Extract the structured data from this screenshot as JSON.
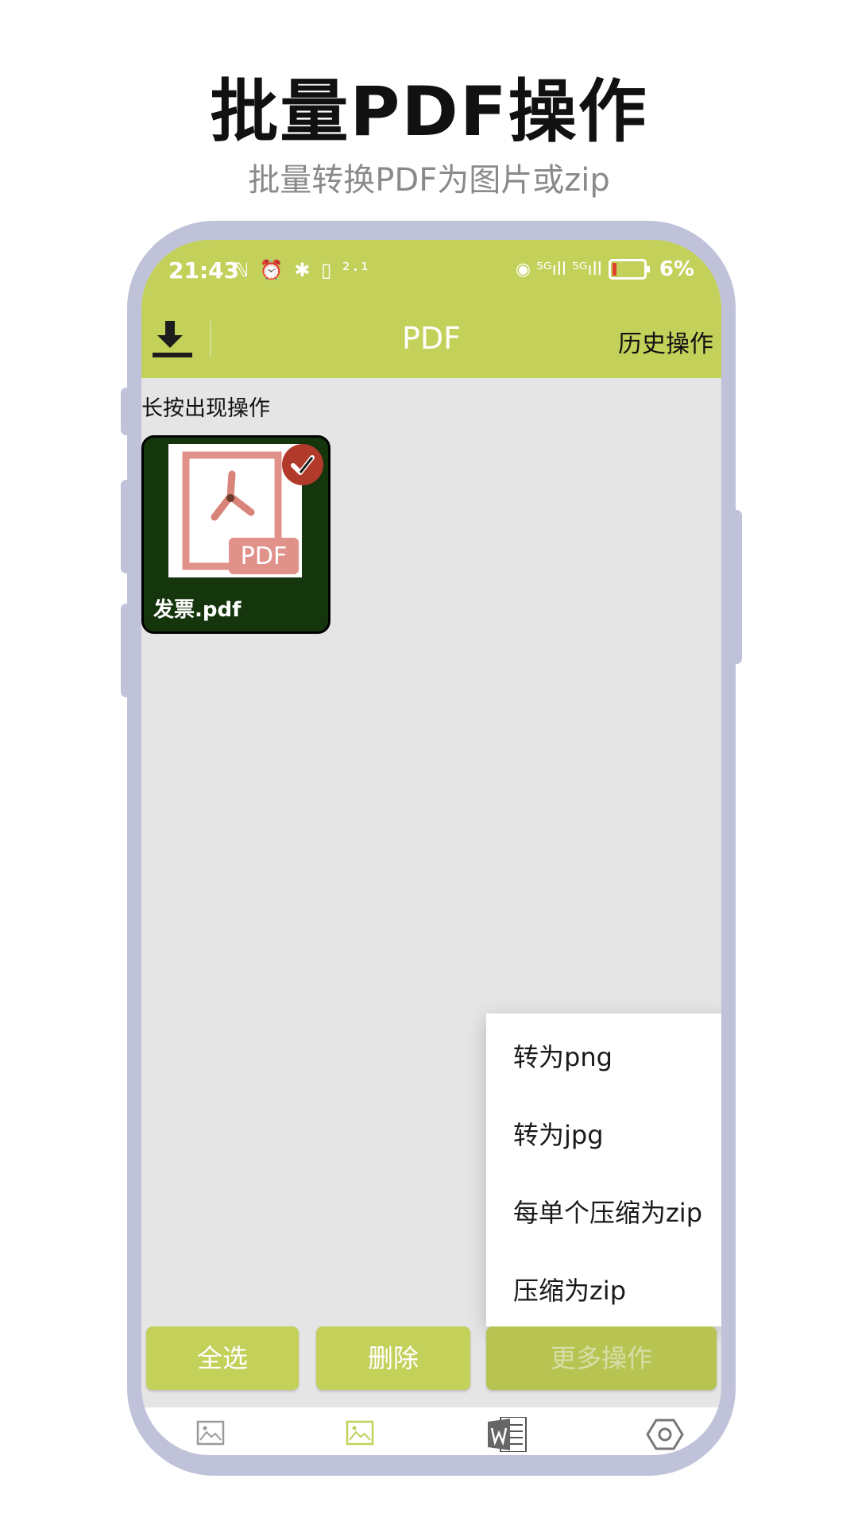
{
  "promo": {
    "headline": "批量PDF操作",
    "subheadline": "批量转换PDF为图片或zip"
  },
  "status_bar": {
    "time": "21:43",
    "left_icons": "ℕ ⏰ ✱ ▯ ²·¹",
    "net_icons": "◉ ⁵ᴳıll ⁵ᴳıll",
    "battery": "6%"
  },
  "app_bar": {
    "title": "PDF",
    "history_label": "历史操作",
    "download_icon": "download-icon"
  },
  "content": {
    "hint": "长按出现操作",
    "files": [
      {
        "name": "发票.pdf",
        "thumb_label": "PDF",
        "selected": true
      }
    ]
  },
  "popup_menu": {
    "items": [
      "转为png",
      "转为jpg",
      "每单个压缩为zip",
      "压缩为zip"
    ]
  },
  "actions": {
    "select_all": "全选",
    "delete": "删除",
    "more": "更多操作"
  },
  "bottom_nav": {
    "items": [
      "image-icon",
      "image-icon-active",
      "word-icon",
      "settings-icon"
    ]
  },
  "colors": {
    "accent": "#c3d05a",
    "frame": "#bfc2d9",
    "screen_bg": "#e5e5e5",
    "card_bg": "#15350d",
    "badge": "#b23a2a"
  }
}
